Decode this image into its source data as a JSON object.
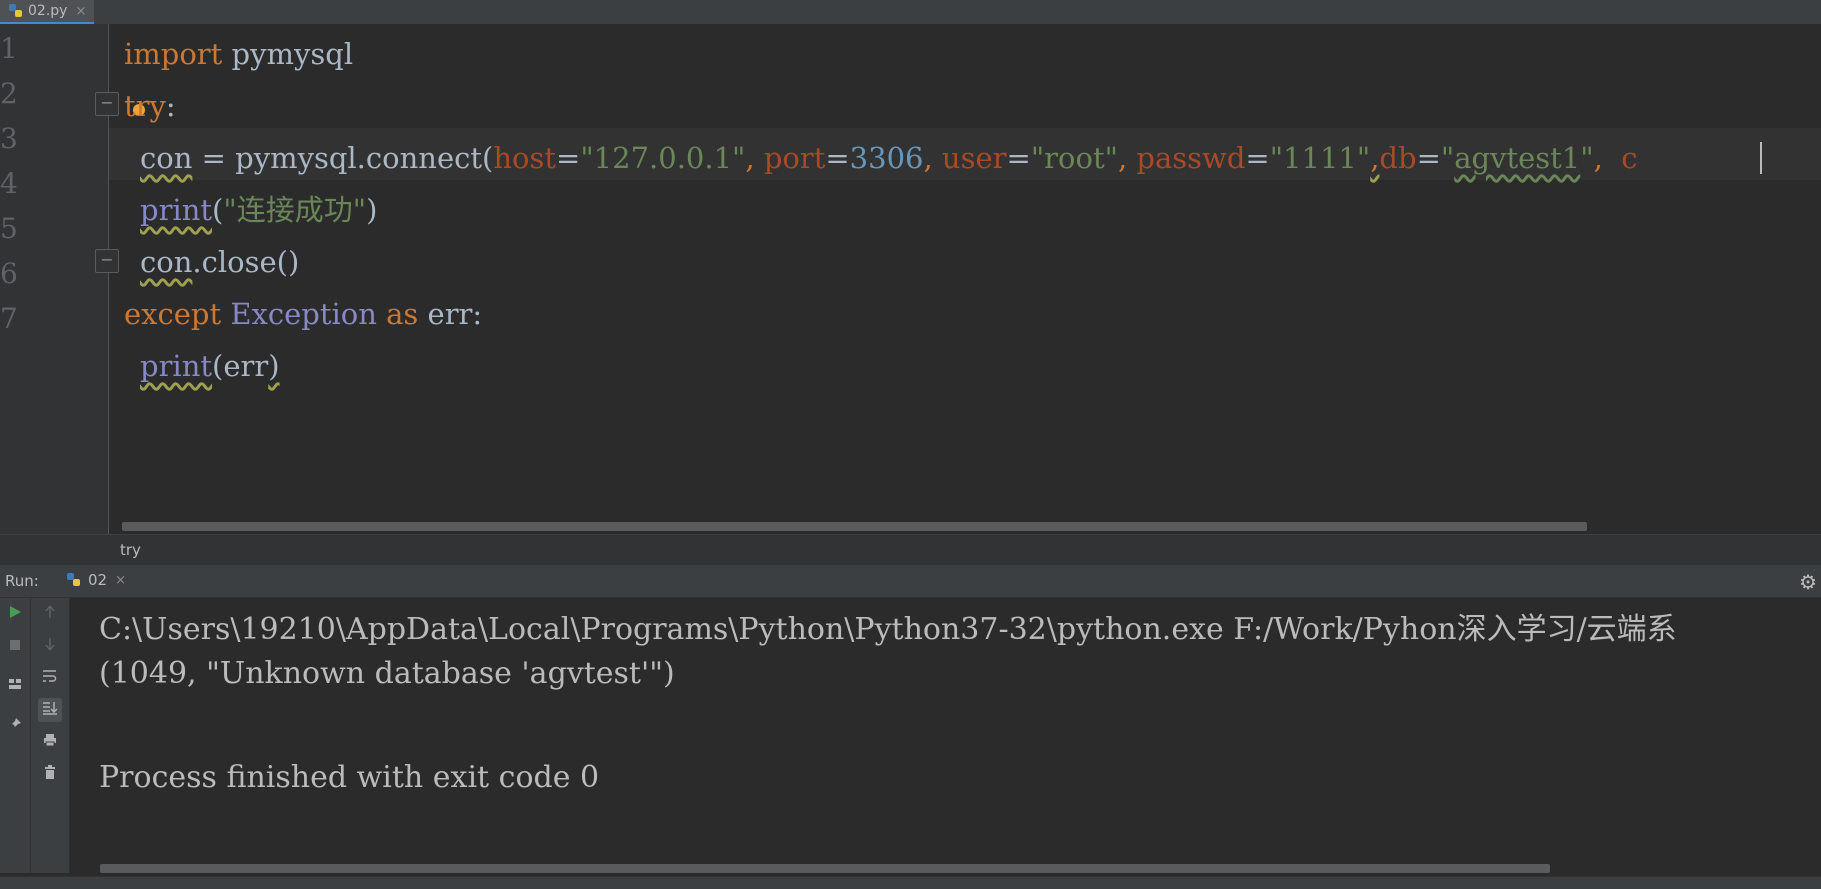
{
  "editor_tab": {
    "label": "02.py",
    "close": "×"
  },
  "gutter": {
    "lines": [
      "1",
      "2",
      "3",
      "4",
      "5",
      "6",
      "7"
    ]
  },
  "code": {
    "line1": {
      "kw": "import",
      "rest": " pymysql"
    },
    "line2": {
      "kw": "try",
      "rest": ":"
    },
    "line3": {
      "var": "con",
      "eq": " = pymysql.connect(",
      "host_k": "host",
      "host_eq": "=",
      "host_v": "\"127.0.0.1\"",
      "sep1": ", ",
      "port_k": "port",
      "port_eq": "=",
      "port_v": "3306",
      "sep2": ", ",
      "user_k": "user",
      "user_eq": "=",
      "user_v": "\"root\"",
      "sep3": ", ",
      "passwd_k": "passwd",
      "passwd_eq": "=",
      "passwd_v": "\"1111\"",
      "sep4": ",",
      "db_k": "db",
      "db_eq": "=",
      "db_v_q1": "\"",
      "db_v": "agvtest1",
      "db_v_q2": "\"",
      "sep5": ",  ",
      "trail": "c"
    },
    "line4": {
      "fn": "print",
      "open": "(",
      "str": "\"连接成功\"",
      "close": ")"
    },
    "line5": {
      "var": "con",
      "rest": ".close()"
    },
    "line6": {
      "kw1": "except",
      "cls": " Exception",
      "kw2": " as",
      "rest": " err:"
    },
    "line7": {
      "fn": "print",
      "rest": "(err",
      "close": ")"
    }
  },
  "breadcrumb": {
    "label": "try"
  },
  "run": {
    "label": "Run:",
    "tab_label": "02",
    "close": "×"
  },
  "console": {
    "line1": "C:\\Users\\19210\\AppData\\Local\\Programs\\Python\\Python37-32\\python.exe F:/Work/Pyhon深入学习/云端系",
    "line2": "(1049, \"Unknown database 'agvtest'\")",
    "line3": "Process finished with exit code 0"
  },
  "icons": {
    "run": "run-icon",
    "stop": "stop-icon",
    "layout": "layout-icon",
    "pin": "pin-icon",
    "up": "up-arrow-icon",
    "down": "down-arrow-icon",
    "wrap": "soft-wrap-icon",
    "scroll_end": "scroll-to-end-icon",
    "print": "print-icon",
    "trash": "trash-icon",
    "gear": "gear-icon"
  },
  "colors": {
    "keyword": "#cc7832",
    "string": "#6a8759",
    "number": "#6897bb",
    "param": "#aa4926",
    "builtin": "#8888c6",
    "run_green": "#499c54"
  }
}
